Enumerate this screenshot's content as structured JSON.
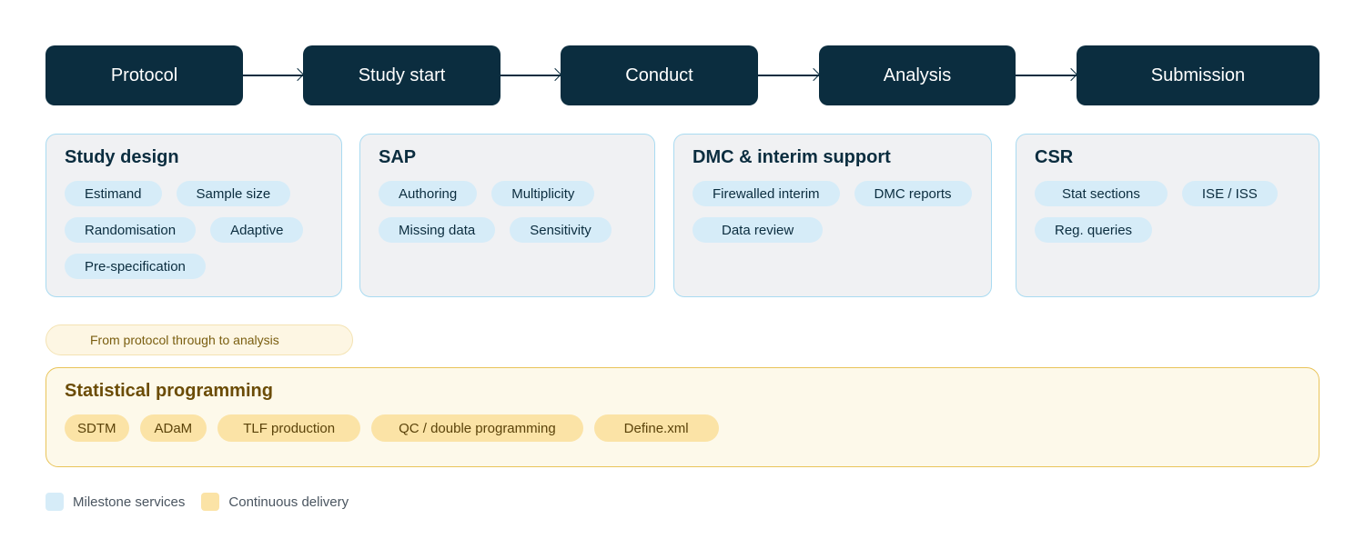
{
  "stages": [
    "Protocol",
    "Study start",
    "Conduct",
    "Analysis",
    "Submission"
  ],
  "cards": [
    {
      "title": "Study design",
      "items": [
        "Estimand",
        "Sample size",
        "Randomisation",
        "Adaptive",
        "Pre-specification"
      ]
    },
    {
      "title": "SAP",
      "items": [
        "Authoring",
        "Multiplicity",
        "Missing data",
        "Sensitivity"
      ]
    },
    {
      "title": "DMC & interim support",
      "items": [
        "Firewalled interim",
        "DMC reports",
        "Data review"
      ]
    },
    {
      "title": "CSR",
      "items": [
        "Stat sections",
        "ISE / ISS",
        "Reg. queries"
      ]
    }
  ],
  "continuous_tag": "From protocol through to analysis",
  "programming": {
    "title": "Statistical programming",
    "items": [
      "SDTM",
      "ADaM",
      "TLF production",
      "QC / double programming",
      "Define.xml"
    ]
  },
  "legend": [
    {
      "label": "Milestone services",
      "color": "#d6ecf8"
    },
    {
      "label": "Continuous delivery",
      "color": "#fbe3a6"
    }
  ]
}
